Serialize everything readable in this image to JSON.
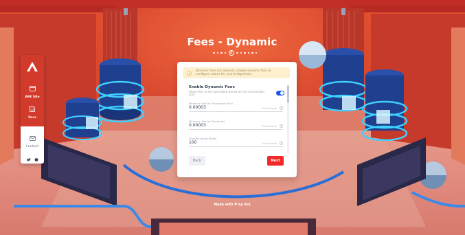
{
  "page": {
    "title": "Fees - Dynamic",
    "current_step": "4",
    "steps_before": 4,
    "steps_after": 6
  },
  "sidebar": {
    "logo_icon": "ark-logo-icon",
    "items": [
      {
        "label": "ARK Site",
        "icon": "browser-window-icon"
      },
      {
        "label": "Docs",
        "icon": "document-icon"
      }
    ],
    "contact": {
      "label": "Contact",
      "icons": [
        "envelope-icon",
        "twitter-icon",
        "discord-icon"
      ]
    }
  },
  "card": {
    "alert_text": "Dynamic fees are optional, enable dynamic fees to configure values for your bridgechain.",
    "alert_icon": "info-icon",
    "section_title": "Enable Dynamic Fees",
    "section_subtitle": "Allow fees to be calculated based on the transaction size.",
    "toggle_on": true,
    "fields": [
      {
        "label": "Minimum Fee for Transaction Pool",
        "value": "0.00003",
        "default_label": "Use Default",
        "help": "?"
      },
      {
        "label": "Minimum Fee for Broadcast",
        "value": "0.00003",
        "default_label": "Use Default",
        "help": "?"
      },
      {
        "label": "Transfer Addon Bytes",
        "value": "100",
        "default_label": "Use Default",
        "help": "?"
      }
    ],
    "back_label": "Back",
    "next_label": "Next"
  },
  "footer": {
    "text_before": "Made with",
    "heart": "♥",
    "text_after": "by Ark"
  },
  "colors": {
    "accent_red": "#f02a2a",
    "toggle_blue": "#1a56f0",
    "alert_bg": "#fdf0cf",
    "sidebar_red": "#d23a2c"
  }
}
